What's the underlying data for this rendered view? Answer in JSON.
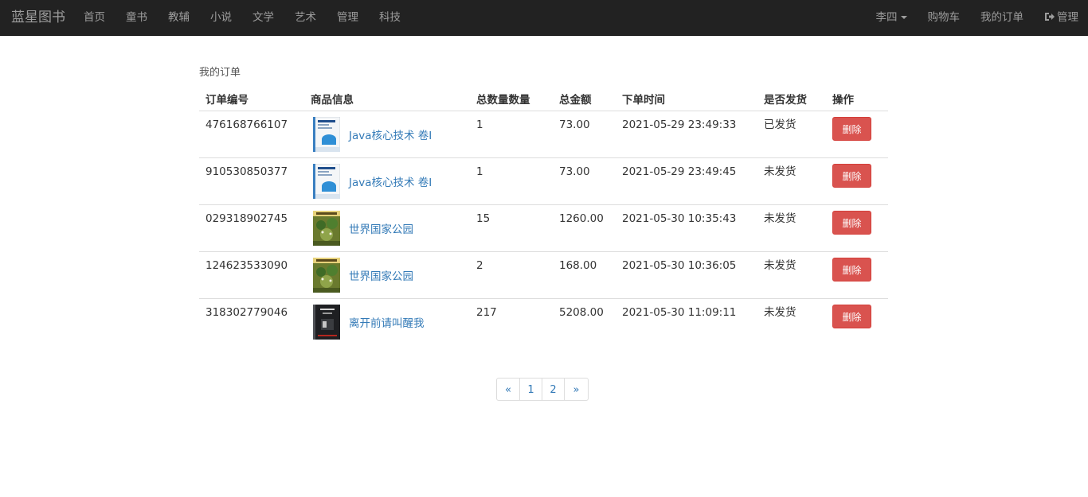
{
  "navbar": {
    "brand": "蓝星图书",
    "links": [
      "首页",
      "童书",
      "教辅",
      "小说",
      "文学",
      "艺术",
      "管理",
      "科技"
    ],
    "user": "李四",
    "cart": "购物车",
    "my_orders": "我的订单",
    "admin": "管理"
  },
  "page": {
    "title": "我的订单"
  },
  "table": {
    "headers": [
      "订单编号",
      "商品信息",
      "总数量数量",
      "总金额",
      "下单时间",
      "是否发货",
      "操作"
    ],
    "rows": [
      {
        "id": "476168766107",
        "product": "Java核心技术 卷I",
        "cover": "java",
        "qty": "1",
        "amount": "73.00",
        "time": "2021-05-29 23:49:33",
        "status": "已发货",
        "action": "删除"
      },
      {
        "id": "910530850377",
        "product": "Java核心技术 卷I",
        "cover": "java",
        "qty": "1",
        "amount": "73.00",
        "time": "2021-05-29 23:49:45",
        "status": "未发货",
        "action": "删除"
      },
      {
        "id": "029318902745",
        "product": "世界国家公园",
        "cover": "park",
        "qty": "15",
        "amount": "1260.00",
        "time": "2021-05-30 10:35:43",
        "status": "未发货",
        "action": "删除"
      },
      {
        "id": "124623533090",
        "product": "世界国家公园",
        "cover": "park",
        "qty": "2",
        "amount": "168.00",
        "time": "2021-05-30 10:36:05",
        "status": "未发货",
        "action": "删除"
      },
      {
        "id": "318302779046",
        "product": "离开前请叫醒我",
        "cover": "dark",
        "qty": "217",
        "amount": "5208.00",
        "time": "2021-05-30 11:09:11",
        "status": "未发货",
        "action": "删除"
      }
    ]
  },
  "pagination": {
    "prev": "«",
    "pages": [
      "1",
      "2"
    ],
    "next": "»"
  },
  "colors": {
    "navbar_bg": "#222222",
    "link": "#337ab7",
    "danger": "#d9534f"
  }
}
